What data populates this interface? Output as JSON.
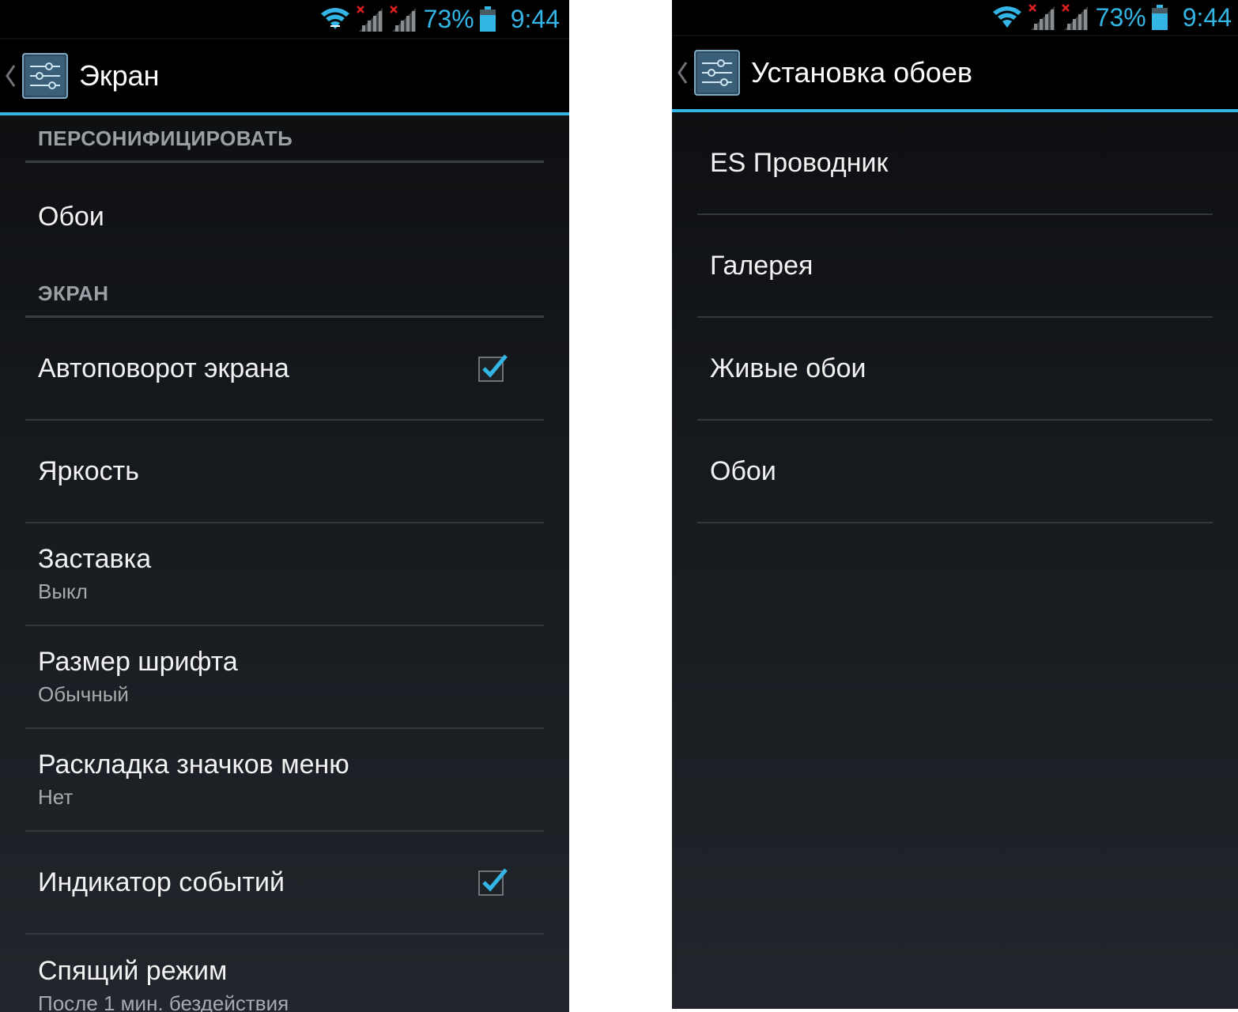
{
  "left": {
    "status": {
      "battery_percent": "73%",
      "time": "9:44"
    },
    "title": "Экран",
    "sections": {
      "personalize": "ПЕРСОНИФИЦИРОВАТЬ",
      "screen": "ЭКРАН"
    },
    "items": {
      "wallpaper": {
        "title": "Обои"
      },
      "autorotate": {
        "title": "Автоповорот экрана",
        "checked": true
      },
      "brightness": {
        "title": "Яркость"
      },
      "daydream": {
        "title": "Заставка",
        "summary": "Выкл"
      },
      "font_size": {
        "title": "Размер шрифта",
        "summary": "Обычный"
      },
      "menu_layout": {
        "title": "Раскладка значков меню",
        "summary": "Нет"
      },
      "notification_light": {
        "title": "Индикатор событий",
        "checked": true
      },
      "sleep": {
        "title": "Спящий режим",
        "summary": "После 1 мин. бездействия"
      }
    }
  },
  "right": {
    "status": {
      "battery_percent": "73%",
      "time": "9:44"
    },
    "title": "Установка обоев",
    "choices": [
      "ES Проводник",
      "Галерея",
      "Живые обои",
      "Обои"
    ]
  },
  "colors": {
    "accent": "#33b5e5",
    "background_top": "#0b0c0e",
    "background_bottom": "#22262c"
  }
}
